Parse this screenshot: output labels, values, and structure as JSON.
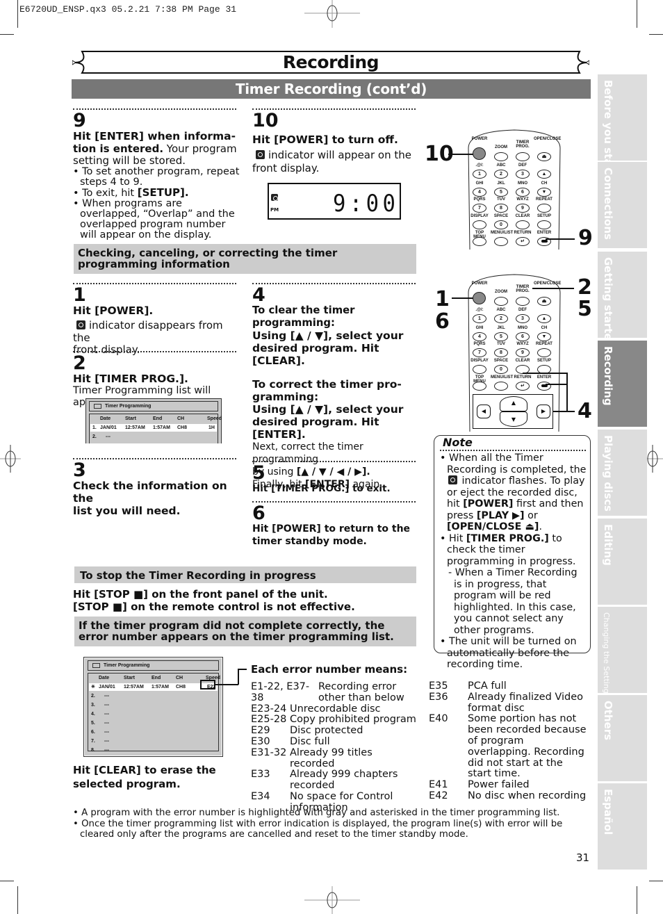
{
  "slug": "E6720UD_ENSP.qx3   05.2.21 7:38 PM   Page 31",
  "header": {
    "title": "Recording",
    "subtitle": "Timer Recording (cont’d)"
  },
  "side_tabs": [
    {
      "label": "Before you start",
      "active": false
    },
    {
      "label": "Connections",
      "active": false
    },
    {
      "label": "Getting started",
      "active": false
    },
    {
      "label": "Recording",
      "active": true
    },
    {
      "label": "Playing discs",
      "active": false
    },
    {
      "label": "Editing",
      "active": false
    },
    {
      "label": "Changing the Setting menu",
      "active": false
    },
    {
      "label": "Others",
      "active": false
    },
    {
      "label": "Español",
      "active": false
    }
  ],
  "step9": {
    "num": "9",
    "head_a": "Hit [ENTER] when informa-",
    "head_b": "tion is entered.",
    "text_b": " Your program",
    "text_c": "setting will be stored.",
    "bullets": [
      "• To set another program, repeat steps 4 to 9.",
      "• When programs are overlapped, “Overlap” and the overlapped program number will appear on the display."
    ],
    "exit_pre": "• To exit, hit ",
    "exit_key": "[SETUP]."
  },
  "step10": {
    "num": "10",
    "head": "Hit [POWER] to turn off.",
    "text_a": "indicator will appear on the",
    "text_b": "front display.",
    "lcd": {
      "pm": "PM",
      "time": "9:00"
    }
  },
  "section_check": "Checking, canceling, or correcting the timer programming information",
  "step1": {
    "num": "1",
    "head": "Hit [POWER].",
    "text_a": "indicator disappears from the",
    "text_b": "front display."
  },
  "step2": {
    "num": "2",
    "head": "Hit [TIMER PROG.].",
    "text": "Timer Programming list will appear."
  },
  "step3": {
    "num": "3",
    "head_a": "Check the information on the",
    "head_b": "list you will need."
  },
  "step4": {
    "num": "4",
    "clear_head": "To clear the timer programming:",
    "clear_body": "Using [▲ / ▼], select your desired program. Hit [CLEAR].",
    "correct_head": "To correct the timer pro- gramming:",
    "correct_body": "Using [▲ / ▼], select your desired program. Hit [ENTER].",
    "next_a": "Next, correct the timer programming",
    "next_b_pre": "by using ",
    "next_b_key": "[▲ / ▼ / ◀ / ▶].",
    "final_pre": "Finally, hit ",
    "final_key": "[ENTER]",
    "final_post": " again."
  },
  "step5": {
    "num": "5",
    "head": "Hit [TIMER PROG.] to exit."
  },
  "step6": {
    "num": "6",
    "head": "Hit [POWER] to return to the timer standby mode."
  },
  "timer_list_small": {
    "title": "Timer Programming",
    "columns": [
      "Date",
      "Start",
      "End",
      "CH",
      "Speed"
    ],
    "rows": [
      {
        "no": "1.",
        "date": "JAN/01",
        "start": "12:57AM",
        "end": "1:57AM",
        "ch": "CH8",
        "speed": "1H"
      },
      {
        "no": "2.",
        "date": "---"
      }
    ]
  },
  "remote": {
    "row_labels": [
      [
        "POWER",
        "ZOOM",
        "TIMER PROG.",
        "OPEN/CLOSE"
      ],
      [
        ".@/:",
        "ABC",
        "DEF",
        ""
      ],
      [
        "GHI",
        "JKL",
        "MNO",
        "CH"
      ],
      [
        "PQRS",
        "TUV",
        "WXYZ",
        "REPEAT"
      ],
      [
        "DISPLAY",
        "SPACE",
        "CLEAR",
        "SETUP"
      ],
      [
        "TOP MENU",
        "MENU/LIST",
        "RETURN",
        "ENTER"
      ]
    ],
    "digits": [
      "1",
      "2",
      "3",
      "4",
      "5",
      "6",
      "7",
      "8",
      "9",
      "0"
    ],
    "callouts_top": {
      "left": "10",
      "right": "9"
    },
    "callouts_bottom": {
      "left_a": "1",
      "left_b": "6",
      "right_a": "2",
      "right_b": "5",
      "right_c": "4"
    }
  },
  "note": {
    "title": "Note",
    "items": [
      {
        "pre": "• When all the Timer Recording is completed, the ",
        "post": " indicator flashes. To play or eject the recorded disc, hit ",
        "k1": "[POWER]",
        "mid": " first and then press ",
        "k2": "[PLAY ▶]",
        "mid2": " or ",
        "k3": "[OPEN/CLOSE ⏏]",
        "end": "."
      },
      {
        "pre": "• Hit ",
        "k1": "[TIMER PROG.]",
        "post": " to check the timer programming in progress."
      },
      {
        "sub": "- When a Timer Recording is in progress, that program will be red highlighted. In this case, you cannot select any other programs."
      },
      {
        "pre": "• The unit will be turned on automatically before the recording time."
      }
    ]
  },
  "section_stop": "To stop the Timer Recording in progress",
  "stop_a": "Hit [STOP ■] on the front panel of the unit.",
  "stop_b": "[STOP ■] on the remote control is not effective.",
  "section_error": "If the timer program did not complete correctly, the error number appears on the timer programming list.",
  "timer_list_error": {
    "title": "Timer Programming",
    "columns": [
      "Date",
      "Start",
      "End",
      "CH",
      "Speed"
    ],
    "rows": [
      {
        "no": "✳",
        "date": "JAN/01",
        "start": "12:57AM",
        "end": "1:57AM",
        "ch": "CH8",
        "speed": "E22"
      },
      {
        "no": "2.",
        "date": "---"
      },
      {
        "no": "3.",
        "date": "---"
      },
      {
        "no": "4.",
        "date": "---"
      },
      {
        "no": "5.",
        "date": "---"
      },
      {
        "no": "6.",
        "date": "---"
      },
      {
        "no": "7.",
        "date": "---"
      },
      {
        "no": "8.",
        "date": "---"
      }
    ]
  },
  "clear_hint_a": "Hit [CLEAR] to erase the",
  "clear_hint_b": "selected program.",
  "errors_head": "Each error number means:",
  "errors_left": [
    {
      "code": "E1-22, E37-38",
      "desc": "Recording error other than below"
    },
    {
      "code": "E23-24",
      "desc": "Unrecordable disc"
    },
    {
      "code": "E25-28",
      "desc": "Copy prohibited program"
    },
    {
      "code": "E29",
      "desc": "Disc protected"
    },
    {
      "code": "E30",
      "desc": "Disc full"
    },
    {
      "code": "E31-32",
      "desc": "Already 99 titles recorded"
    },
    {
      "code": "E33",
      "desc": "Already 999 chapters recorded"
    },
    {
      "code": "E34",
      "desc": "No space for Control information"
    }
  ],
  "errors_right": [
    {
      "code": "E35",
      "desc": "PCA full"
    },
    {
      "code": "E36",
      "desc": "Already finalized Video format disc"
    },
    {
      "code": "E40",
      "desc": "Some portion has not been recorded because of program overlapping. Recording did not start at the start time."
    },
    {
      "code": "E41",
      "desc": "Power failed"
    },
    {
      "code": "E42",
      "desc": "No disc when recording"
    }
  ],
  "footnotes": [
    "• A program with the error number is highlighted with gray and asterisked in the timer programming list.",
    "• Once the timer programming list with error indication is displayed, the program line(s) with error will be cleared only after the programs are cancelled and reset to the timer standby mode."
  ],
  "page_number": "31"
}
